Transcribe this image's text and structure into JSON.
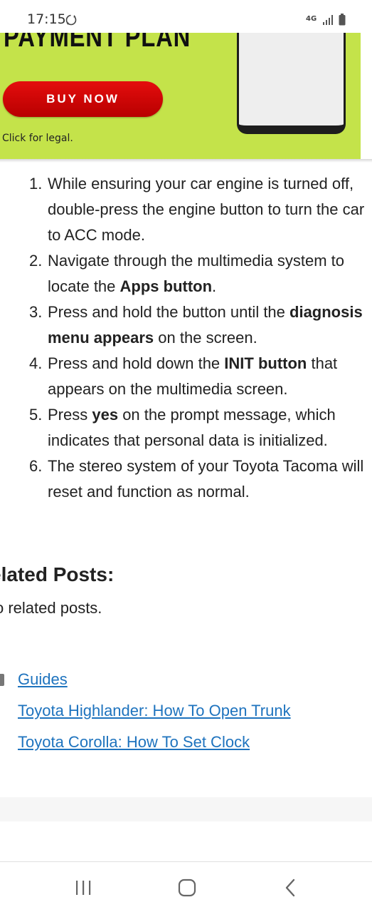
{
  "status_bar": {
    "time": "17:15",
    "network_label": "4G",
    "icons": [
      "sync-icon",
      "signal-icon",
      "battery-icon"
    ]
  },
  "ad": {
    "title": "PAYMENT PLAN",
    "button_label": "BUY NOW",
    "legal_text": "Click for legal.",
    "colors": {
      "background": "#c4e34a",
      "button": "#d40000"
    }
  },
  "steps": [
    {
      "num": "1.",
      "parts": [
        {
          "text": "While ensuring your car engine is turned off, double-press the engine button to turn the car to ACC mode.",
          "bold": false
        }
      ]
    },
    {
      "num": "2.",
      "parts": [
        {
          "text": "Navigate through the multimedia system to locate the ",
          "bold": false
        },
        {
          "text": "Apps button",
          "bold": true
        },
        {
          "text": ".",
          "bold": false
        }
      ]
    },
    {
      "num": "3.",
      "parts": [
        {
          "text": "Press and hold the button until the ",
          "bold": false
        },
        {
          "text": "diagnosis menu appears",
          "bold": true
        },
        {
          "text": " on the screen.",
          "bold": false
        }
      ]
    },
    {
      "num": "4.",
      "parts": [
        {
          "text": "Press and hold down the ",
          "bold": false
        },
        {
          "text": "INIT button",
          "bold": true
        },
        {
          "text": " that appears on the multimedia screen.",
          "bold": false
        }
      ]
    },
    {
      "num": "5.",
      "parts": [
        {
          "text": "Press ",
          "bold": false
        },
        {
          "text": "yes",
          "bold": true
        },
        {
          "text": " on the prompt message, which indicates that personal data is initialized.",
          "bold": false
        }
      ]
    },
    {
      "num": "6.",
      "parts": [
        {
          "text": "The stereo system of your Toyota Tacoma will reset and function as normal.",
          "bold": false
        }
      ]
    }
  ],
  "related": {
    "heading": "elated Posts:",
    "text": "o related posts."
  },
  "links": {
    "category": "Guides",
    "prev": "Toyota Highlander: How To Open Trunk",
    "next": "Toyota Corolla: How To Set Clock",
    "color": "#1e73be"
  },
  "nav": {
    "icons": [
      "recent-apps-icon",
      "home-icon",
      "back-icon"
    ]
  }
}
